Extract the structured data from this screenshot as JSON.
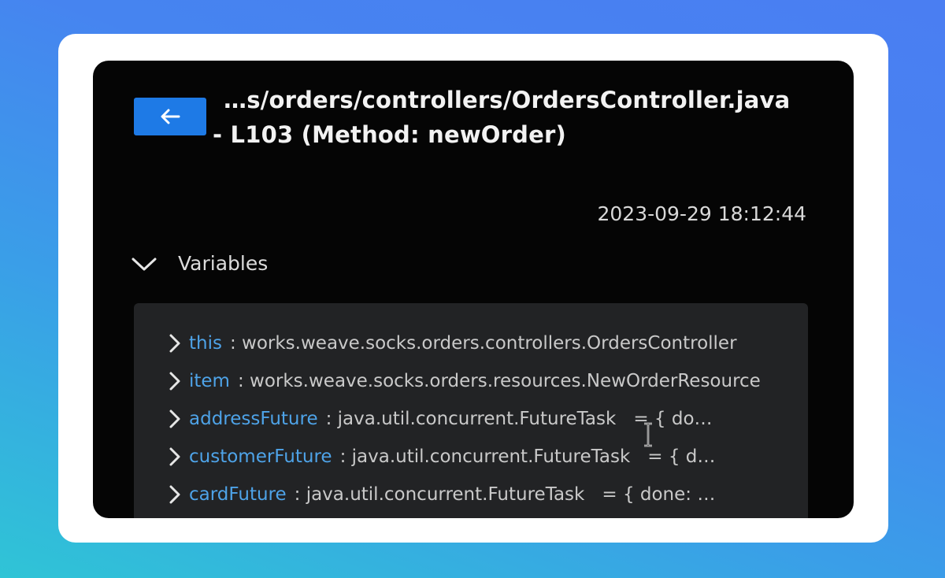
{
  "header": {
    "title_line1": "…s/orders/controllers/OrdersController.java",
    "title_line2": "- L103 (Method: newOrder)",
    "back_icon": "arrow-left-icon"
  },
  "timestamp": "2023-09-29 18:12:44",
  "variables_section": {
    "label": "Variables",
    "expanded": true,
    "items": [
      {
        "name": "this",
        "type": ": works.weave.socks.orders.controllers.OrdersController",
        "value": ""
      },
      {
        "name": "item",
        "type": ": works.weave.socks.orders.resources.NewOrderResource",
        "value": ""
      },
      {
        "name": "addressFuture",
        "type": ": java.util.concurrent.FutureTask",
        "value": "= { do…"
      },
      {
        "name": "customerFuture",
        "type": ": java.util.concurrent.FutureTask",
        "value": "= { d…"
      },
      {
        "name": "cardFuture",
        "type": ": java.util.concurrent.FutureTask",
        "value": "= { done: …"
      }
    ]
  },
  "colors": {
    "accent": "#1e7ae6",
    "variable_name": "#4ea3e8",
    "panel_bg": "#050505"
  }
}
